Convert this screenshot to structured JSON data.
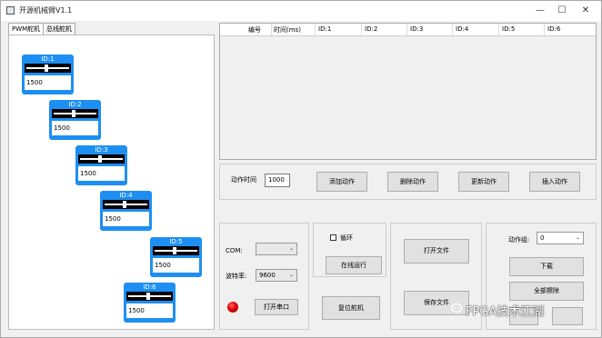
{
  "window": {
    "title": "开源机械臂V1.1",
    "minimize": "—",
    "maximize": "☐",
    "close": "✕"
  },
  "tabs": [
    "PWM舵机",
    "总线舵机"
  ],
  "servos": [
    {
      "label": "ID:1",
      "value": "1500"
    },
    {
      "label": "ID:2",
      "value": "1500"
    },
    {
      "label": "ID:3",
      "value": "1500"
    },
    {
      "label": "ID:4",
      "value": "1500"
    },
    {
      "label": "ID:5",
      "value": "1500"
    },
    {
      "label": "ID:6",
      "value": "1500"
    }
  ],
  "table": {
    "columns": [
      "编号",
      "时间(ms)",
      "ID:1",
      "ID:2",
      "ID:3",
      "ID:4",
      "ID:5",
      "ID:6"
    ]
  },
  "actions": {
    "time_label": "动作时间",
    "time_value": "1000",
    "add": "添加动作",
    "delete": "删除动作",
    "update": "更新动作",
    "insert": "插入动作"
  },
  "serial": {
    "com_label": "COM:",
    "com_value": "",
    "baud_label": "波特率:",
    "baud_value": "9600",
    "open": "打开串口"
  },
  "run": {
    "loop": "循环",
    "online": "在线运行",
    "reset": "复位舵机"
  },
  "file": {
    "open": "打开文件",
    "save": "保存文件"
  },
  "group": {
    "label": "动作组:",
    "value": "0",
    "download": "下载",
    "erase_all": "全部擦除"
  },
  "watermark": "FPGA技术江湖",
  "colors": {
    "servo_blue": "#1e8ff2",
    "led_red": "#e00000"
  }
}
